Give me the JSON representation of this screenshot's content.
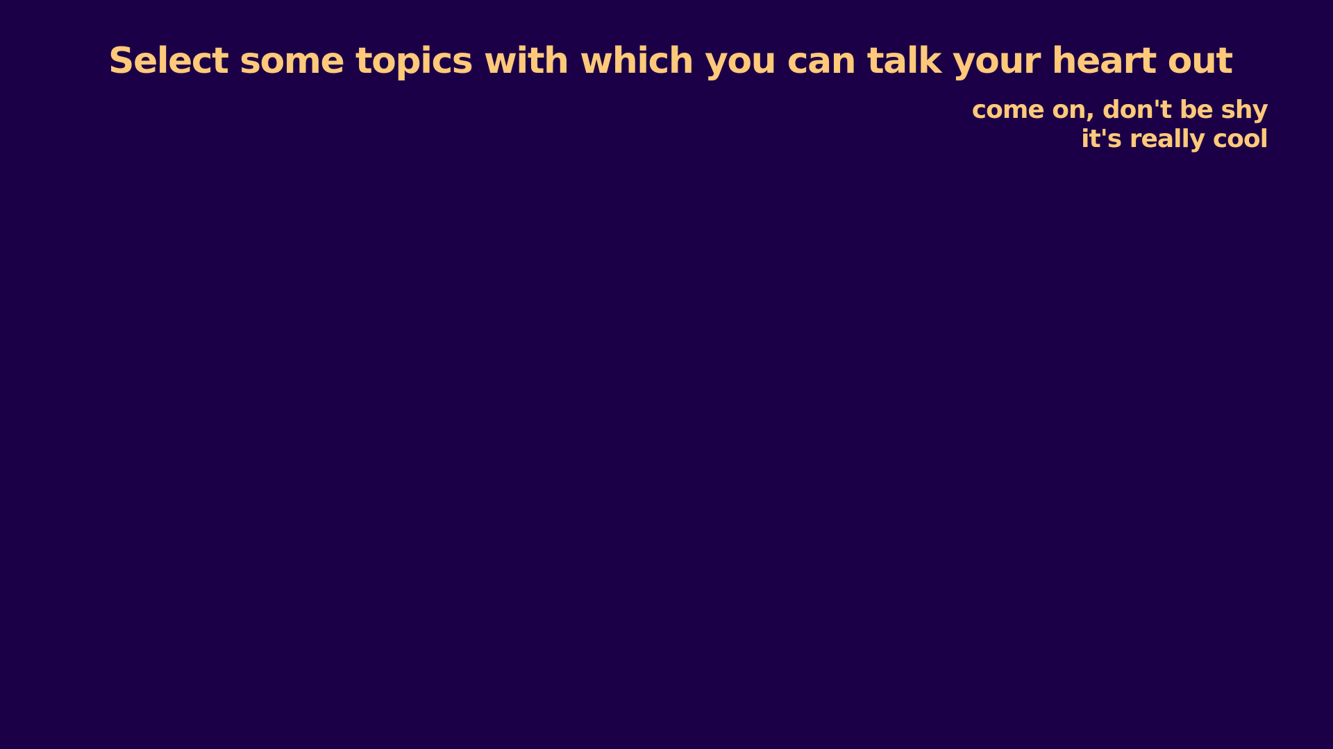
{
  "header": {
    "title": "Select some topics with which you can talk your heart out",
    "subtitle_lines": [
      "come on, don't be shy",
      "it's really cool"
    ]
  },
  "colors": {
    "background": "#1b0047",
    "text": "#ffc97a"
  }
}
